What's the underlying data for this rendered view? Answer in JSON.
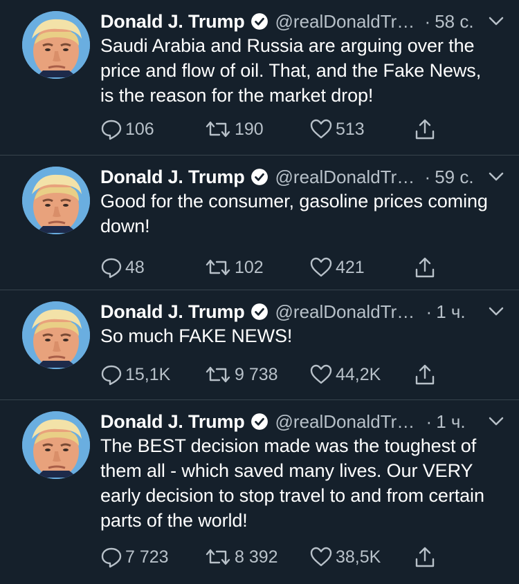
{
  "tweets": [
    {
      "name": "Donald J. Trump",
      "handle": "@realDonaldTrump",
      "time": "58 с.",
      "text": "Saudi Arabia and Russia are arguing over the price and flow of oil. That, and the Fake News, is the reason for the market drop!",
      "replies": "106",
      "retweets": "190",
      "likes": "513"
    },
    {
      "name": "Donald J. Trump",
      "handle": "@realDonaldTrump",
      "time": "59 с.",
      "text": "Good for the consumer, gasoline prices coming down!",
      "replies": "48",
      "retweets": "102",
      "likes": "421"
    },
    {
      "name": "Donald J. Trump",
      "handle": "@realDonaldTrump",
      "time": "1 ч.",
      "text": "So much FAKE NEWS!",
      "replies": "15,1K",
      "retweets": "9 738",
      "likes": "44,2K"
    },
    {
      "name": "Donald J. Trump",
      "handle": "@realDonaldTrump",
      "time": "1 ч.",
      "text": "The BEST decision made was the toughest of them all - which saved many lives. Our VERY early decision to stop travel to and from certain parts of the world!",
      "replies": "7 723",
      "retweets": "8 392",
      "likes": "38,5K"
    }
  ],
  "separator": "·",
  "colors": {
    "background": "#15202b",
    "divider": "#38444d",
    "secondary_text": "#b8c1c9",
    "primary_text": "#ffffff"
  },
  "icons": {
    "verified": "verified-badge-icon",
    "caret": "chevron-down-icon",
    "reply": "reply-icon",
    "retweet": "retweet-icon",
    "like": "heart-icon",
    "share": "share-icon",
    "avatar": "profile-photo"
  }
}
